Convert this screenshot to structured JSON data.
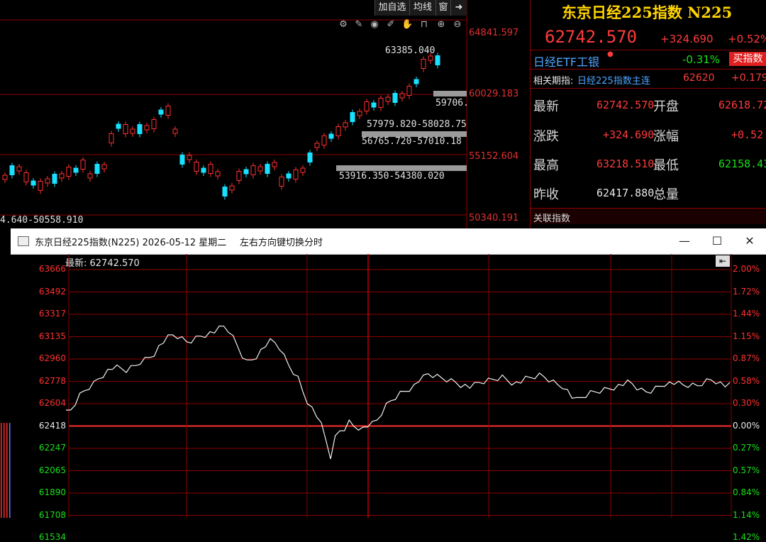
{
  "kline_toolbar": {
    "add_watch": "加自选",
    "ma": "均线",
    "window": "窗"
  },
  "kline_prices": {
    "p1": "64841.597",
    "p2": "60029.183",
    "p3": "55152.604",
    "p4": "50340.191"
  },
  "kline_bands": {
    "high_marker": "63385.040",
    "b1": "59706.",
    "b2": "57979.820-58028.75",
    "b3": "56765.720-57010.18",
    "b4": "53916.350-54380.020",
    "b5": "4.640-50558.910"
  },
  "quote": {
    "title": "东京日经225指数 N225",
    "price": "62742.570",
    "change": "+324.690",
    "change_pct": "+0.52%",
    "etf_name": "日经ETF工银",
    "etf_pct": "-0.31%",
    "buy_button": "买指数",
    "futures_label": "相关期指:",
    "futures_name": "日经225指数主连",
    "futures_price": "62620",
    "futures_pct": "+0.179",
    "rows": [
      {
        "l1": "最新",
        "v1": "62742.570",
        "l2": "开盘",
        "v2": "62618.72"
      },
      {
        "l1": "涨跌",
        "v1": "+324.690",
        "l2": "涨幅",
        "v2": "+0.52"
      },
      {
        "l1": "最高",
        "v1": "63218.510",
        "l2": "最低",
        "v2": "62158.43"
      },
      {
        "l1": "昨收",
        "v1": "62417.880",
        "l2": "总量",
        "v2": ""
      }
    ],
    "related": "关联指数"
  },
  "popup": {
    "title": "东京日经225指数(N225) 2026-05-12 星期二",
    "hint": "左右方向键切换分时",
    "latest_label": "最新: 62742.570",
    "minimize": "—",
    "maximize": "☐",
    "close": "✕"
  },
  "intraday_axis": {
    "left": [
      "63666",
      "63492",
      "63317",
      "63135",
      "62960",
      "62778",
      "62604",
      "62418",
      "62247",
      "62065",
      "61890",
      "61708",
      "61534"
    ],
    "right": [
      "2.00%",
      "1.72%",
      "1.44%",
      "1.15%",
      "0.87%",
      "0.58%",
      "0.30%",
      "0.00%",
      "0.27%",
      "0.57%",
      "0.84%",
      "1.14%",
      "1.42%"
    ]
  },
  "intraday_series": [
    62520,
    62540,
    62600,
    62660,
    62700,
    62730,
    62760,
    62800,
    62830,
    62860,
    62880,
    62880,
    62870,
    62860,
    62880,
    62900,
    62930,
    62950,
    62970,
    63000,
    63050,
    63090,
    63120,
    63140,
    63130,
    63110,
    63090,
    63100,
    63120,
    63140,
    63150,
    63160,
    63170,
    63190,
    63210,
    63180,
    63120,
    63050,
    62980,
    62930,
    62950,
    62980,
    63020,
    63060,
    63090,
    63080,
    63040,
    62970,
    62900,
    62850,
    62800,
    62700,
    62620,
    62560,
    62500,
    62420,
    62300,
    62170,
    62320,
    62380,
    62400,
    62450,
    62420,
    62410,
    62400,
    62420,
    62430,
    62460,
    62520,
    62580,
    62620,
    62650,
    62680,
    62700,
    62720,
    62740,
    62780,
    62800,
    62830,
    62820,
    62810,
    62800,
    62790,
    62780,
    62770,
    62750,
    62740,
    62730,
    62740,
    62760,
    62770,
    62780,
    62790,
    62800,
    62810,
    62790,
    62770,
    62760,
    62770,
    62790,
    62800,
    62810,
    62820,
    62810,
    62790,
    62770,
    62750,
    62740,
    62700,
    62650,
    62620,
    62640,
    62660,
    62680,
    62690,
    62700,
    62710,
    62720,
    62730,
    62740,
    62750,
    62760,
    62750,
    62720,
    62700,
    62690,
    62700,
    62720,
    62740,
    62760,
    62760,
    62760,
    62750,
    62740,
    62740,
    62740,
    62740,
    62760,
    62780,
    62790,
    62780,
    62760,
    62740,
    62740
  ]
}
